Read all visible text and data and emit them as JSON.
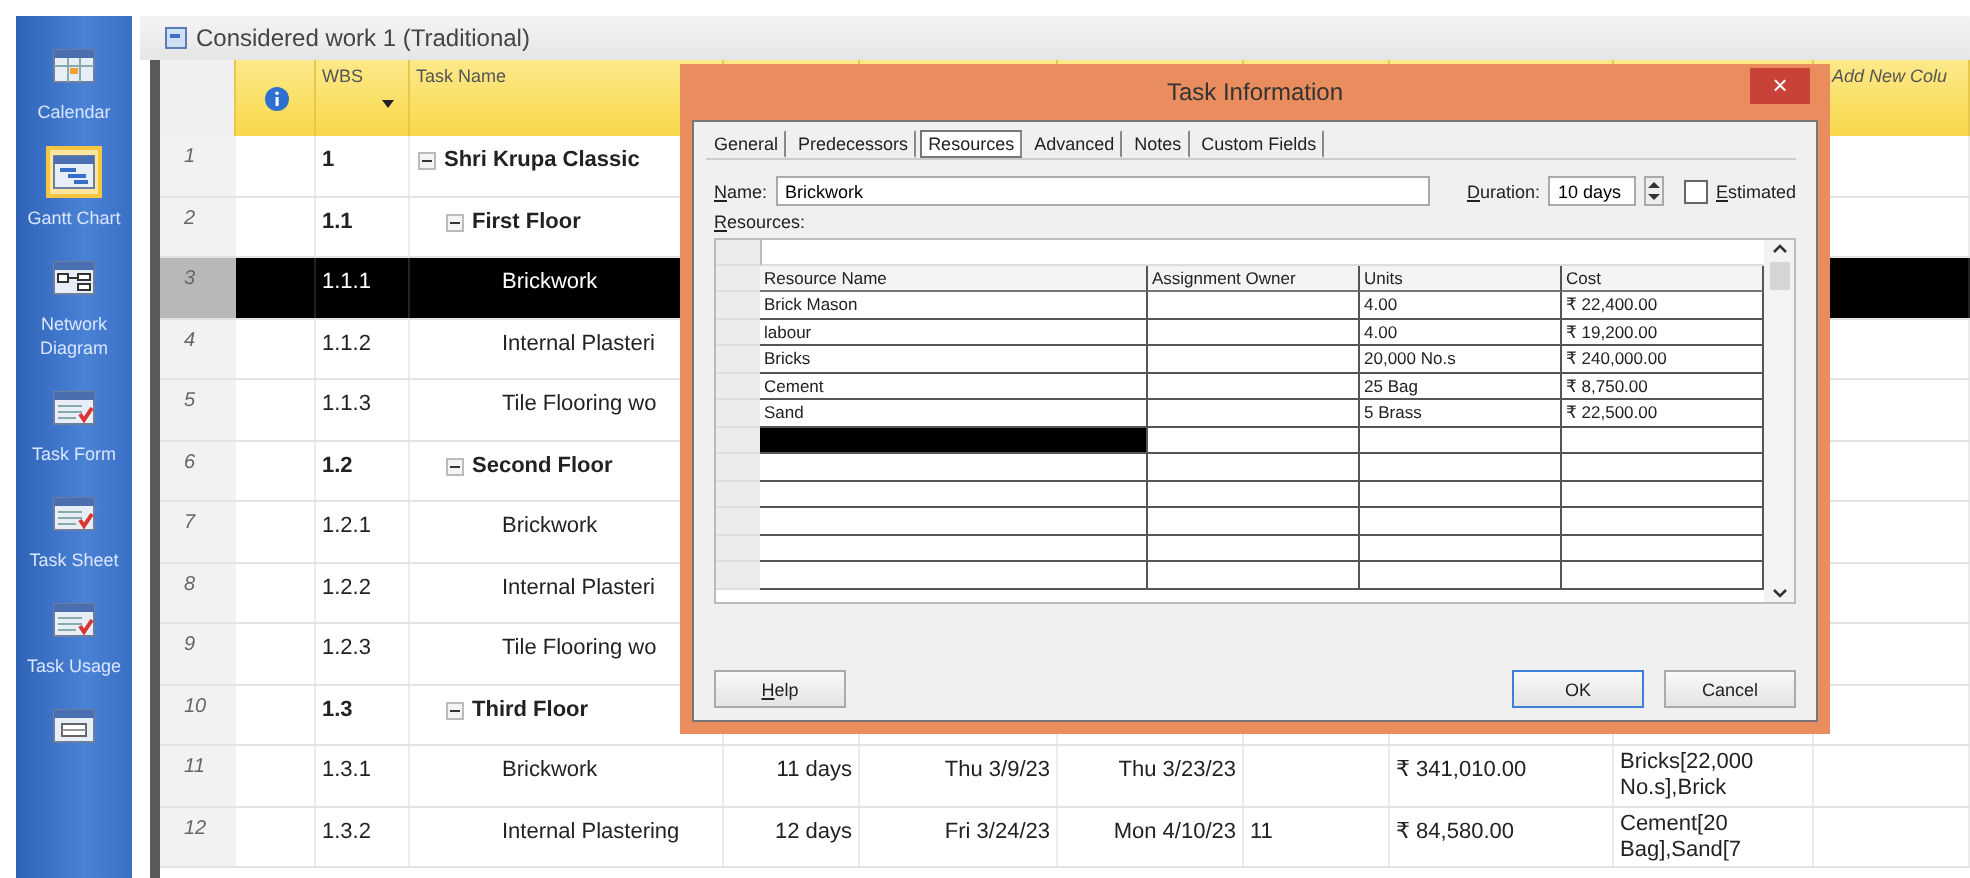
{
  "sidebar": {
    "items": [
      {
        "label": "Calendar",
        "selected": false
      },
      {
        "label": "Gantt Chart",
        "selected": true
      },
      {
        "label": "Network Diagram",
        "selected": false
      },
      {
        "label": "Task Form",
        "selected": false
      },
      {
        "label": "Task Sheet",
        "selected": false
      },
      {
        "label": "Task Usage",
        "selected": false
      },
      {
        "selected": false
      }
    ]
  },
  "project": {
    "title": "Considered work 1 (Traditional)",
    "header": {
      "wbs": "WBS",
      "task_name": "Task Name",
      "add_new_column": "Add New Colu"
    },
    "tasks": [
      {
        "id": "1",
        "wbs": "1",
        "name": "Shri Krupa Classic",
        "selected": false,
        "expanded": true,
        "children": [
          {
            "id": "2",
            "wbs": "1.1",
            "name": "First Floor",
            "selected": false,
            "expanded": true,
            "children": [
              {
                "id": "3",
                "wbs": "1.1.1",
                "name": "Brickwork",
                "selected": true
              },
              {
                "id": "4",
                "wbs": "1.1.2",
                "name": "Internal Plasteri",
                "selected": false
              },
              {
                "id": "5",
                "wbs": "1.1.3",
                "name": "Tile Flooring wo",
                "selected": false
              }
            ]
          },
          {
            "id": "6",
            "wbs": "1.2",
            "name": "Second Floor",
            "selected": false,
            "expanded": true,
            "children": [
              {
                "id": "7",
                "wbs": "1.2.1",
                "name": "Brickwork",
                "selected": false
              },
              {
                "id": "8",
                "wbs": "1.2.2",
                "name": "Internal Plasteri",
                "selected": false
              },
              {
                "id": "9",
                "wbs": "1.2.3",
                "name": "Tile Flooring wo",
                "selected": false
              }
            ]
          },
          {
            "id": "10",
            "wbs": "1.3",
            "name": "Third Floor",
            "selected": false,
            "expanded": true,
            "children": [
              {
                "id": "11",
                "wbs": "1.3.1",
                "name": "Brickwork",
                "selected": false,
                "duration": "11 days",
                "start": "Thu 3/9/23",
                "finish": "Thu 3/23/23",
                "cost": "₹ 341,010.00",
                "resource_names": "Bricks[22,000 No.s],Brick"
              },
              {
                "id": "12",
                "wbs": "1.3.2",
                "name": "Internal Plastering",
                "selected": false,
                "duration": "12 days",
                "start": "Fri 3/24/23",
                "finish": "Mon 4/10/23",
                "predecessors": "11",
                "cost": "₹ 84,580.00",
                "resource_names": "Cement[20 Bag],Sand[7"
              }
            ]
          }
        ]
      }
    ]
  },
  "dialog": {
    "title": "Task Information",
    "close": "×",
    "tabs": [
      {
        "label": "General",
        "selected": false
      },
      {
        "label": "Predecessors",
        "selected": false
      },
      {
        "label": "Resources",
        "selected": true
      },
      {
        "label": "Advanced",
        "selected": false
      },
      {
        "label": "Notes",
        "selected": false
      },
      {
        "label": "Custom Fields",
        "selected": false
      }
    ],
    "name_label": "Name:",
    "name_value": "Brickwork",
    "duration_label": "Duration:",
    "duration_value": "10 days",
    "estimated": {
      "label": "Estimated",
      "checked": false
    },
    "resources_label": "Resources:",
    "columns": [
      "Resource Name",
      "Assignment Owner",
      "Units",
      "Cost"
    ],
    "rows": [
      {
        "resource": "Brick Mason",
        "units": "4.00",
        "cost": "₹ 22,400.00",
        "selected": false
      },
      {
        "resource": "labour",
        "units": "4.00",
        "cost": "₹ 19,200.00",
        "selected": false
      },
      {
        "resource": "Bricks",
        "units": "20,000 No.s",
        "cost": "₹ 240,000.00",
        "selected": false
      },
      {
        "resource": "Cement",
        "units": "25 Bag",
        "cost": "₹ 8,750.00",
        "selected": false
      },
      {
        "resource": "Sand",
        "units": "5 Brass",
        "cost": "₹ 22,500.00",
        "selected": false
      },
      {
        "selected": true
      }
    ],
    "buttons": {
      "help": "Help",
      "ok": "OK",
      "cancel": "Cancel"
    }
  }
}
